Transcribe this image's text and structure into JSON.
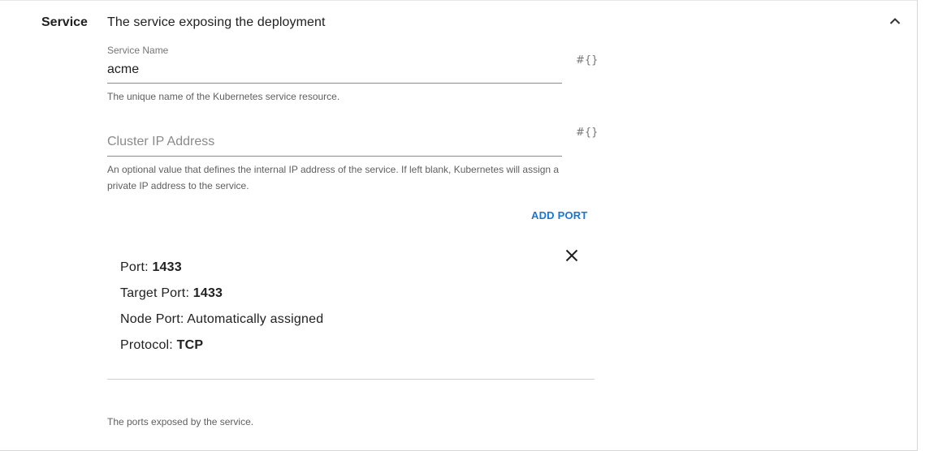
{
  "section": {
    "title": "Service",
    "description": "The service exposing the deployment"
  },
  "service_name": {
    "label": "Service Name",
    "value": "acme",
    "hint": "The unique name of the Kubernetes service resource.",
    "expr_icon": "#{}"
  },
  "cluster_ip": {
    "placeholder": "Cluster IP Address",
    "value": "",
    "hint": "An optional value that defines the internal IP address of the service. If left blank, Kubernetes will assign a private IP address to the service.",
    "expr_icon": "#{}"
  },
  "ports": {
    "add_label": "ADD PORT",
    "hint": "The ports exposed by the service.",
    "items": [
      {
        "port_label": "Port: ",
        "port_value": "1433",
        "target_label": "Target Port: ",
        "target_value": "1433",
        "node_label": "Node Port: ",
        "node_value": "Automatically assigned",
        "protocol_label": "Protocol: ",
        "protocol_value": "TCP"
      }
    ]
  },
  "colors": {
    "accent": "#1976d2",
    "text": "#212121",
    "muted": "#757575"
  }
}
